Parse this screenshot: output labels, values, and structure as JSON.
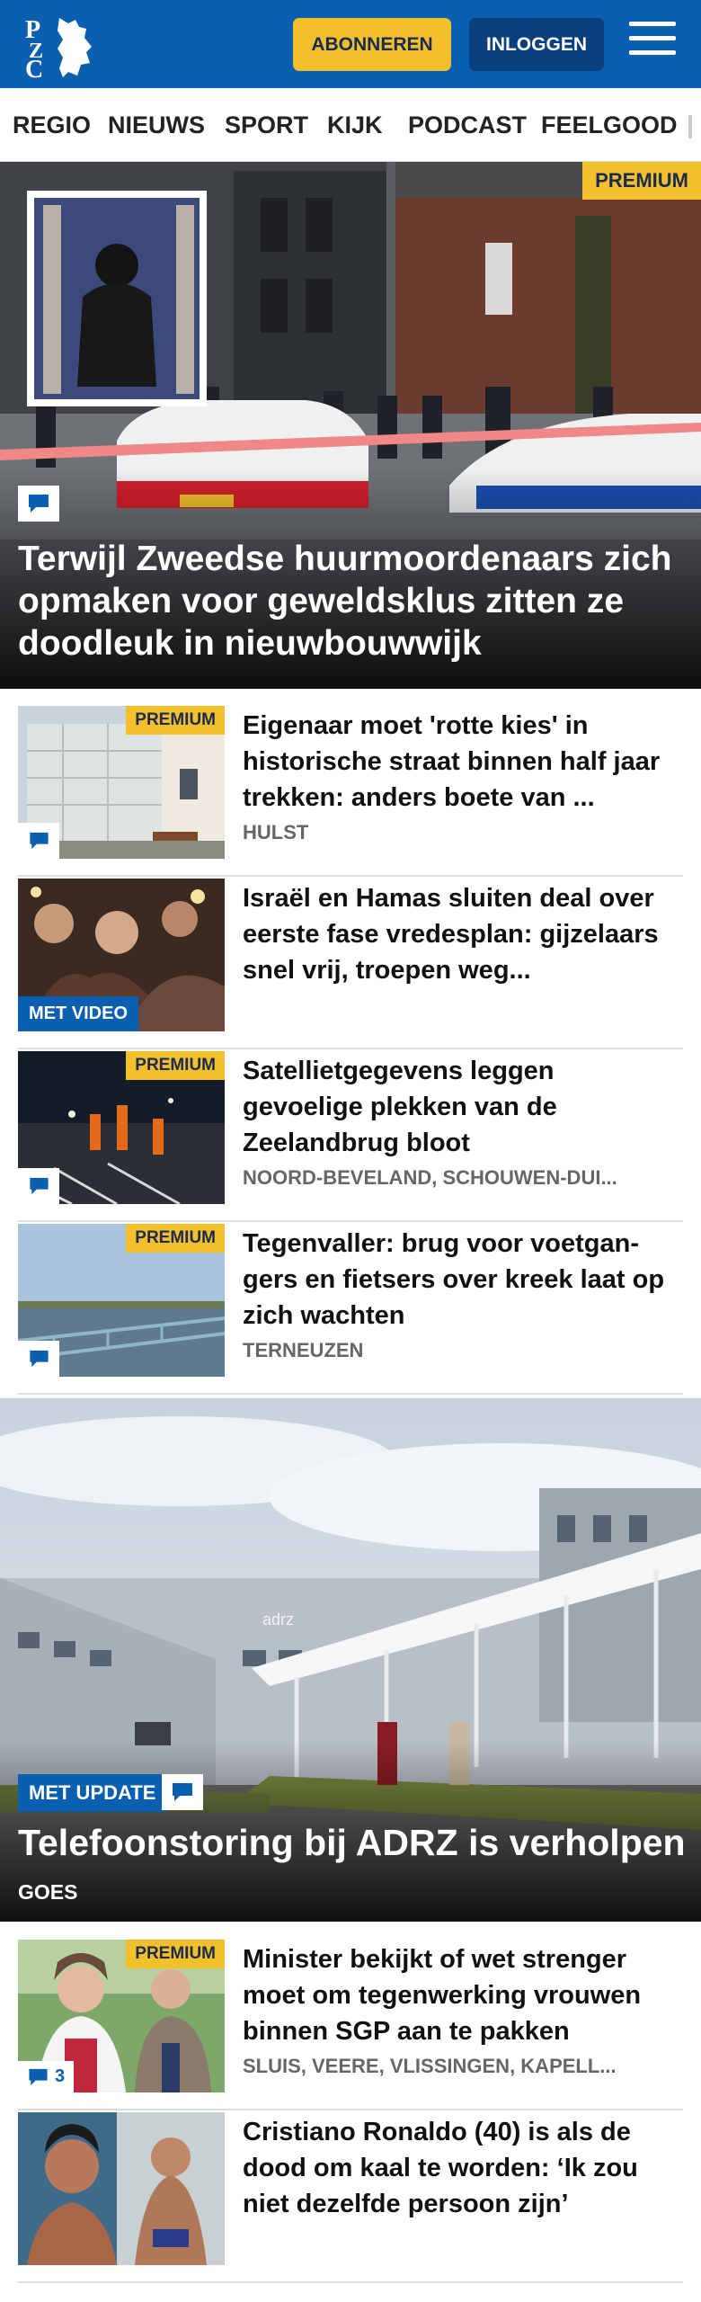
{
  "header": {
    "logo_text": "PZC",
    "subscribe_label": "ABONNEREN",
    "login_label": "INLOGGEN",
    "brand_color": "#0b5fb0",
    "accent_color": "#f2c02b"
  },
  "nav": {
    "items": [
      {
        "label": "REGIO"
      },
      {
        "label": "NIEUWS"
      },
      {
        "label": "SPORT"
      },
      {
        "label": "KIJK"
      },
      {
        "label": "PODCAST"
      },
      {
        "label": "FEELGOOD"
      }
    ]
  },
  "hero": {
    "badge": "PREMIUM",
    "title": "Terwijl Zweedse huurmoordenaars zich opmaken voor geweldsklus zitten ze doodleuk in nieuwbouwwijk",
    "icon": "comment-icon"
  },
  "articles": [
    {
      "badge": "PREMIUM",
      "title": "Eigenaar moet 'rotte kies' in historische straat binnen half jaar trekken: anders boete van ...",
      "location": "HULST",
      "has_comments": true
    },
    {
      "badge": "MET VIDEO",
      "title": "Israël en Hamas sluiten deal over eerste fase vredesplan: gijzelaars snel vrij, troepen weg...",
      "location": ""
    },
    {
      "badge": "PREMIUM",
      "title": "Satellietgegevens leggen gevoelige plekken van de Zeelandbrug bloot",
      "location": "NOORD-BEVELAND, SCHOUWEN-DUI...",
      "has_comments": true
    },
    {
      "badge": "PREMIUM",
      "title": "Tegenvaller: brug voor voetgan­gers en fietsers over kreek laat op zich wachten",
      "location": "TERNEUZEN",
      "has_comments": true
    }
  ],
  "hero2": {
    "badge": "MET UPDATE",
    "title": "Telefoonstoring bij ADRZ is verholpen",
    "location": "GOES",
    "sign_text": "adrz"
  },
  "articles2": [
    {
      "badge": "PREMIUM",
      "title": "Minister bekijkt of wet strenger moet om tegenwerking vrouwen binnen SGP aan te pakken",
      "location": "SLUIS, VEERE, VLISSINGEN, KAPELL...",
      "comment_count": "3"
    },
    {
      "badge": "",
      "title": "Cristiano Ronaldo (40) is als de dood om kaal te worden: ‘Ik zou niet dezelfde persoon zijn’",
      "location": ""
    }
  ]
}
